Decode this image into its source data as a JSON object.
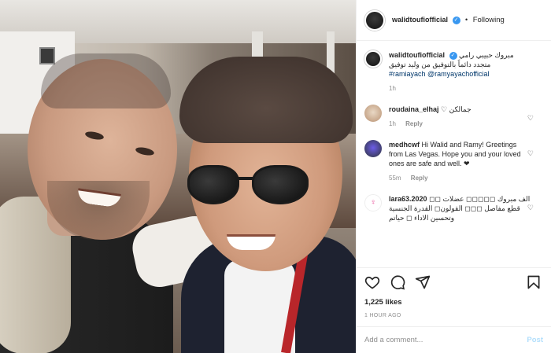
{
  "header": {
    "username": "walidtoufiofficial",
    "separator": "•",
    "follow_status": "Following",
    "verified_glyph": "✓"
  },
  "caption": {
    "username": "walidtoufiofficial",
    "text": "مبروك حبيبي رامي متجدد دائماً بالتوفيق من وليد توفيق",
    "hashtag": "#ramiayach",
    "mention": "@ramyayachofficial",
    "time": "1h"
  },
  "comments": [
    {
      "username": "roudaina_elhaj",
      "text": "جمالكن ♡",
      "time": "1h",
      "reply_label": "Reply"
    },
    {
      "username": "medhcwf",
      "text": "Hi Walid and Ramy! Greetings from Las Vegas. Hope you and your loved ones are safe and well. ❤",
      "time": "55m",
      "reply_label": "Reply"
    },
    {
      "username": "lara63.2020",
      "text": "الف مبروك ◻◻◻◻◻ عضلات ◻◻ قطع مفاصل ◻◻◻ القولون◻ القدرة الجنسية وتحسين الاداء ◻ حياتم"
    }
  ],
  "actions": {
    "icons": [
      "heart-icon",
      "comment-icon",
      "share-icon",
      "bookmark-icon"
    ],
    "likes": "1,225 likes",
    "timestamp": "1 HOUR AGO"
  },
  "add_comment": {
    "placeholder": "Add a comment...",
    "post_label": "Post"
  },
  "colors": {
    "link": "#00376b",
    "verified": "#3897f0",
    "post_disabled": "#b2dffc",
    "muted": "#8e8e8e"
  }
}
